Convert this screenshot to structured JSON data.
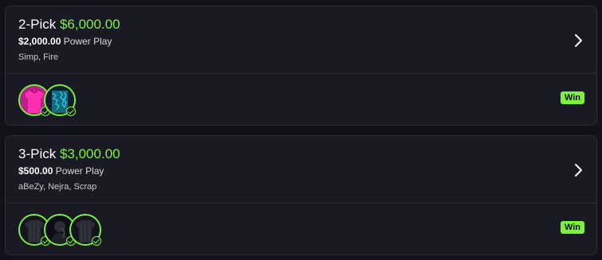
{
  "cards": [
    {
      "pick_label": "2-Pick",
      "payout": "$6,000.00",
      "entry": "$2,000.00",
      "mode": "Power Play",
      "players": "Simp, Fire",
      "avatars": [
        "jersey-pink",
        "jersey-teal-pattern"
      ],
      "result": "Win"
    },
    {
      "pick_label": "3-Pick",
      "payout": "$3,000.00",
      "entry": "$500.00",
      "mode": "Power Play",
      "players": "aBeZy, Nejra, Scrap",
      "avatars": [
        "jersey-black",
        "player-photo-dark",
        "jersey-black"
      ],
      "result": "Win"
    }
  ],
  "colors": {
    "accent": "#7cf23a",
    "card_bg": "#191a24",
    "page_bg": "#11121a"
  }
}
